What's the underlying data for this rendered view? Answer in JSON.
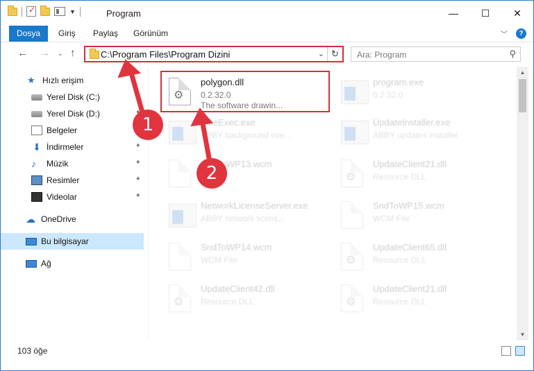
{
  "window": {
    "title": "Program",
    "minimize_icon": "—",
    "maximize_icon": "☐",
    "close_icon": "✕"
  },
  "ribbon": {
    "tabs": [
      {
        "label": "Dosya"
      },
      {
        "label": "Giriş"
      },
      {
        "label": "Paylaş"
      },
      {
        "label": "Görünüm"
      }
    ],
    "help_icon": "?"
  },
  "address": {
    "path": "C:\\Program Files\\Program Dizini"
  },
  "search": {
    "placeholder": "Ara: Program"
  },
  "sidebar": {
    "items": [
      {
        "label": "Hızlı erişim",
        "icon": "star-icon"
      },
      {
        "label": "Yerel Disk (C:)",
        "icon": "disk-icon",
        "pinned": true
      },
      {
        "label": "Yerel Disk (D:)",
        "icon": "disk-icon",
        "pinned": true
      },
      {
        "label": "Belgeler",
        "icon": "document-icon",
        "pinned": true
      },
      {
        "label": "İndirmeler",
        "icon": "download-icon",
        "pinned": true
      },
      {
        "label": "Müzik",
        "icon": "music-icon",
        "pinned": true
      },
      {
        "label": "Resimler",
        "icon": "pictures-icon",
        "pinned": true
      },
      {
        "label": "Videolar",
        "icon": "videos-icon",
        "pinned": true
      },
      {
        "label": "OneDrive",
        "icon": "cloud-icon"
      },
      {
        "label": "Bu bilgisayar",
        "icon": "computer-icon",
        "selected": true
      },
      {
        "label": "Ağ",
        "icon": "network-icon"
      }
    ]
  },
  "files": [
    {
      "name": "polygon.dll",
      "line2": "0.2.32.0",
      "line3": "The software drawin...",
      "kind": "dll",
      "highlighted": true
    },
    {
      "name": "program.exe",
      "line2": "0.2.32.0",
      "line3": "",
      "kind": "exe"
    },
    {
      "name": "...neExec.exe",
      "line2": "ABBY background exe...",
      "line3": "",
      "kind": "exe"
    },
    {
      "name": "UpdateInstaller.exe",
      "line2": "ABBY updates installer",
      "line3": "",
      "kind": "exe"
    },
    {
      "name": "SndToWP13.wcm",
      "line2": "",
      "line3": "",
      "kind": "file"
    },
    {
      "name": "UpdateClient21.dll",
      "line2": "Resource DLL",
      "line3": "",
      "kind": "dll"
    },
    {
      "name": "NetworkLicenseServer.exe",
      "line2": "ABBY network licens...",
      "line3": "",
      "kind": "exe"
    },
    {
      "name": "SndToWP15.wcm",
      "line2": "WCM File",
      "line3": "",
      "kind": "file"
    },
    {
      "name": "SndToWP14.wcm",
      "line2": "WCM File",
      "line3": "",
      "kind": "file"
    },
    {
      "name": "UpdateClient65.dll",
      "line2": "Resource DLL",
      "line3": "",
      "kind": "dll"
    },
    {
      "name": "UpdateClient42.dll",
      "line2": "Resource DLL",
      "line3": "",
      "kind": "dll"
    },
    {
      "name": "UpdateClient21.dll",
      "line2": "Resource DLL",
      "line3": "",
      "kind": "dll"
    }
  ],
  "status": {
    "item_count": "103 öğe"
  },
  "annotations": {
    "step1": "1",
    "step2": "2",
    "accent_color": "#e0343f"
  }
}
